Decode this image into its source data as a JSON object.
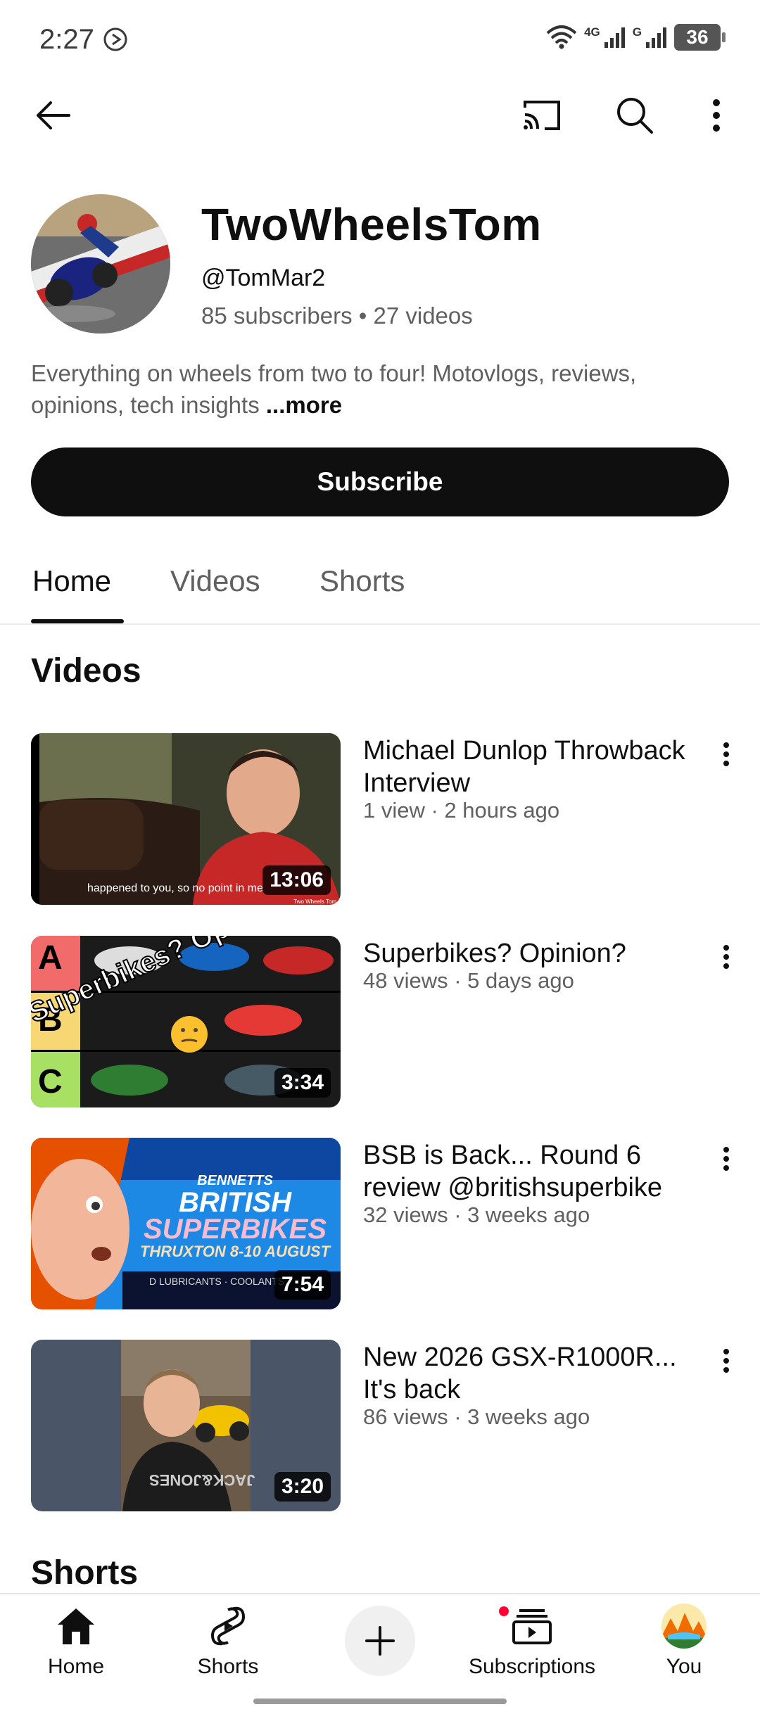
{
  "status_bar": {
    "time": "2:27",
    "network_1": "4G",
    "network_2": "G",
    "battery": "36"
  },
  "channel": {
    "name": "TwoWheelsTom",
    "handle": "@TomMar2",
    "stats": "85 subscribers • 27 videos",
    "description": "Everything on wheels from two to four! Motovlogs, reviews, opinions, tech insights ",
    "more_label": "...more",
    "subscribe_label": "Subscribe"
  },
  "tabs": [
    {
      "label": "Home",
      "active": true
    },
    {
      "label": "Videos",
      "active": false
    },
    {
      "label": "Shorts",
      "active": false
    }
  ],
  "sections": {
    "videos_title": "Videos",
    "shorts_title": "Shorts"
  },
  "videos": [
    {
      "title": "Michael Dunlop Throwback Interview",
      "meta": "1 view · 2 hours ago",
      "duration": "13:06",
      "thumb_caption": "happened to you, so no point in me",
      "thumb_watermark": "Two Wheels Tom"
    },
    {
      "title": "Superbikes? Opinion?",
      "meta": "48 views · 5 days ago",
      "duration": "3:34",
      "thumb_overlay": "Superbikes? Opinion?",
      "tiers": [
        "A",
        "B",
        "C"
      ]
    },
    {
      "title": "BSB is Back... Round 6 review @britishsuperbike",
      "meta": "32 views · 3 weeks ago",
      "duration": "7:54",
      "thumb_line1": "BENNETTS",
      "thumb_line2": "BRITISH",
      "thumb_line3": "SUPERBIKES",
      "thumb_line4": "THRUXTON 8-10 AUGUST",
      "thumb_line5": "D LUBRICANTS · COOLANTS"
    },
    {
      "title": "New 2026 GSX-R1000R... It's back",
      "meta": "86 views · 3 weeks ago",
      "duration": "3:20",
      "thumb_shirt": "JACK&JONES"
    }
  ],
  "bottom_nav": {
    "home": "Home",
    "shorts": "Shorts",
    "subscriptions": "Subscriptions",
    "you": "You"
  },
  "colors": {
    "accent_red": "#ff0033",
    "text_primary": "#0f0f0f",
    "text_secondary": "#606060"
  }
}
